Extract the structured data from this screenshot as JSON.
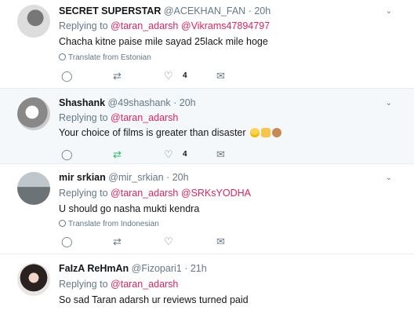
{
  "tweets": [
    {
      "name": "SECRET SUPERSTAR",
      "handle": "@ACEKHAN_FAN",
      "time": "· 20h",
      "replying_prefix": "Replying to",
      "mentions": [
        "@taran_adarsh",
        "@Vikrams47894797"
      ],
      "text": "Chacha kitne paise mile sayad 25lack mile hoge",
      "translate": "Translate from Estonian",
      "likes": "4"
    },
    {
      "name": "Shashank",
      "handle": "@49shashank",
      "time": "· 20h",
      "replying_prefix": "Replying to",
      "mentions": [
        "@taran_adarsh"
      ],
      "text": "Your choice of films is greater than disaster",
      "likes": "4"
    },
    {
      "name": "mir srkian",
      "handle": "@mir_srkian",
      "time": "· 20h",
      "replying_prefix": "Replying to",
      "mentions": [
        "@taran_adarsh",
        "@SRKsYODHA"
      ],
      "text": "U should go nasha mukti kendra",
      "translate": "Translate from Indonesian"
    },
    {
      "name": "FaIzA ReHmAn",
      "handle": "@Fizopari1",
      "time": "· 21h",
      "replying_prefix": "Replying to",
      "mentions": [
        "@taran_adarsh"
      ],
      "text": "So sad Taran adarsh ur reviews turned paid"
    }
  ],
  "icons": {
    "reply": "reply-icon",
    "retweet": "retweet-icon",
    "like": "heart-icon",
    "dm": "message-icon",
    "more": "chevron-down-icon",
    "globe": "globe-icon"
  },
  "colors": {
    "mention": "#e0245e",
    "link": "#1da1f2",
    "retweet_active": "#17bf63"
  }
}
